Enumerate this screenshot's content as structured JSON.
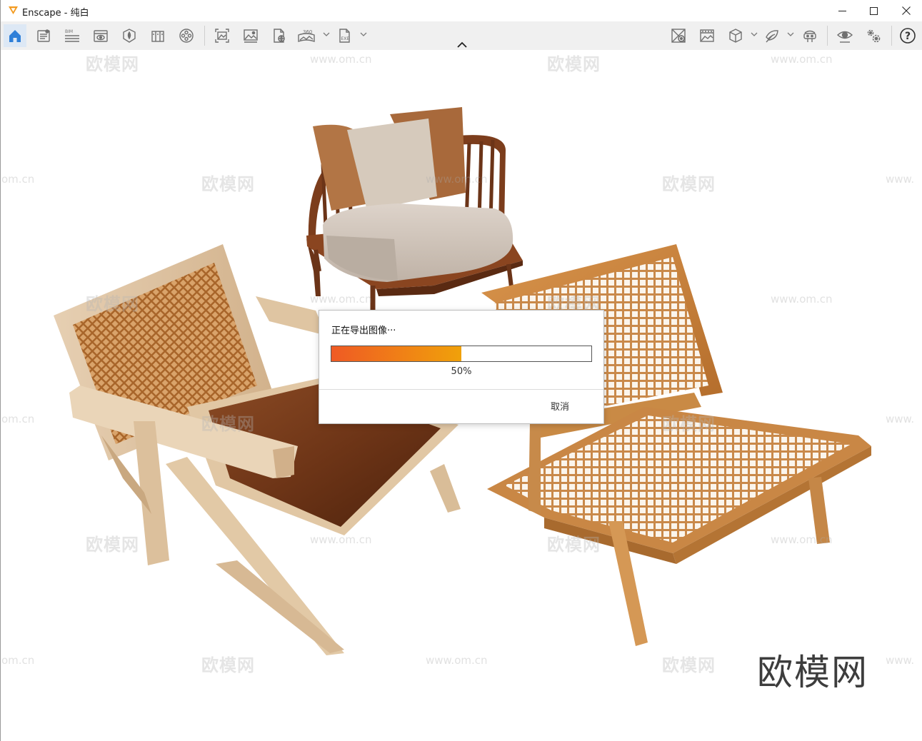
{
  "window": {
    "app_name": "Enscape",
    "separator": " - ",
    "document_name": "纯白",
    "accent_color": "#f39a1e"
  },
  "toolbar": {
    "left_icons": [
      "home-icon",
      "project-info-icon",
      "bim-icon",
      "view-management-icon",
      "asset-library-icon",
      "material-library-icon",
      "video-reel-icon",
      "batch-render-icon",
      "screenshot-icon",
      "web-standalone-icon",
      "panorama-360-icon",
      "export-exe-icon"
    ],
    "bim_label": "BIM",
    "pano_label": "360",
    "exe_label": "EXE",
    "right_icons": [
      "material-editor-icon",
      "atmosphere-icon",
      "cube-views-icon",
      "sketch-mode-icon",
      "vr-headset-icon",
      "visual-settings-icon",
      "settings-icon",
      "help-icon"
    ]
  },
  "watermarks": {
    "text": "欧模网",
    "url": "www.om.cn",
    "url_partial_left": "om.cn",
    "url_partial_right": "www."
  },
  "brand_mark": "欧模网",
  "export_dialog": {
    "title": "正在导出图像···",
    "progress": 0.5,
    "progress_label": "50%",
    "cancel_label": "取消",
    "fill_start_color": "#ef5a24",
    "fill_end_color": "#f0a10a"
  }
}
